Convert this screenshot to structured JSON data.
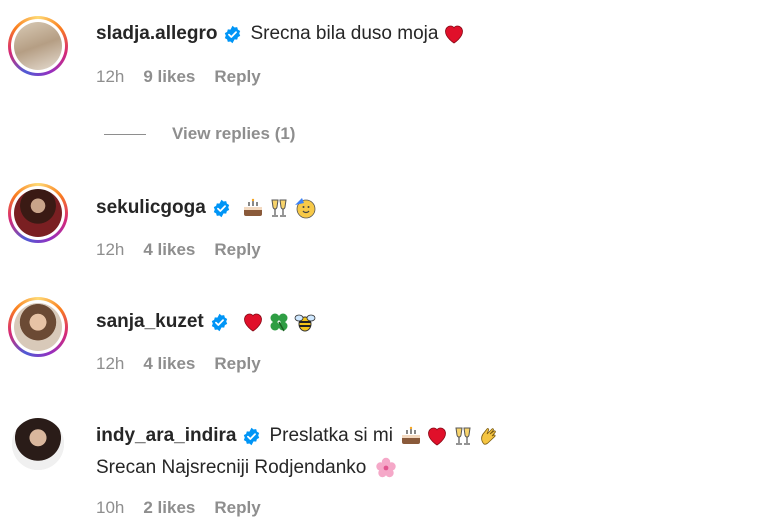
{
  "comments": [
    {
      "username": "sladja.allegro",
      "text": "Srecna bila duso moja",
      "emoji_icons": [
        "red-heart-icon"
      ],
      "time": "12h",
      "likes": "9 likes",
      "reply_label": "Reply",
      "view_replies": "View replies (1)"
    },
    {
      "username": "sekulicgoga",
      "text": "",
      "emoji_icons": [
        "cake-icon",
        "clinking-glasses-icon",
        "partying-face-icon"
      ],
      "time": "12h",
      "likes": "4 likes",
      "reply_label": "Reply"
    },
    {
      "username": "sanja_kuzet",
      "text": "",
      "emoji_icons": [
        "red-heart-icon",
        "four-leaf-clover-icon",
        "bee-icon"
      ],
      "time": "12h",
      "likes": "4 likes",
      "reply_label": "Reply"
    },
    {
      "username": "indy_ara_indira",
      "text": "Preslatka si mi",
      "text_line2": "Srecan Najsrecniji Rodjendanko",
      "emoji_icons": [
        "cake-icon",
        "red-heart-icon",
        "clinking-glasses-icon",
        "clapping-hands-icon"
      ],
      "emoji_icons_line2": [
        "cherry-blossom-icon"
      ],
      "time": "10h",
      "likes": "2 likes",
      "reply_label": "Reply"
    }
  ],
  "colors": {
    "verified_blue": "#0095f6",
    "meta_gray": "#8e8e8e",
    "text": "#262626",
    "heart_red": "#e0102a"
  }
}
